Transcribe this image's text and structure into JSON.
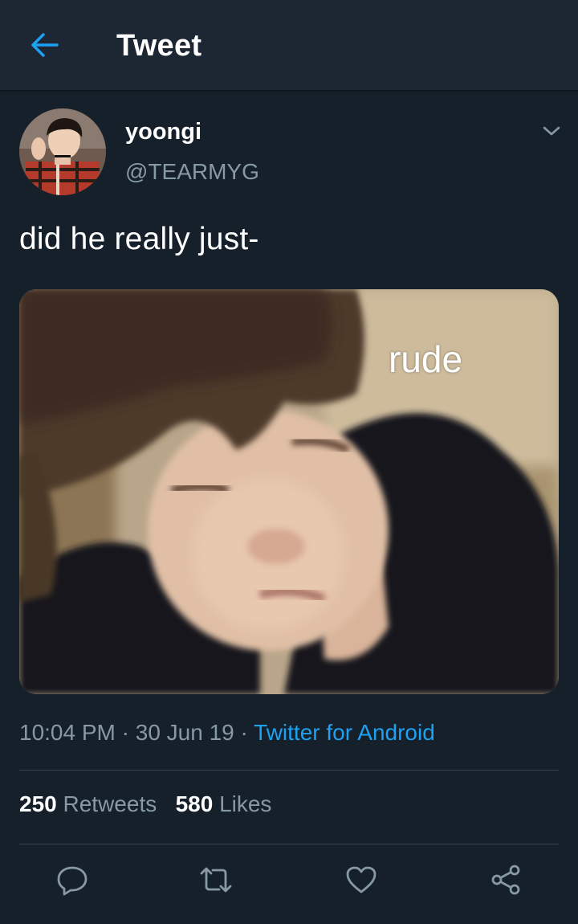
{
  "header": {
    "title": "Tweet",
    "back_icon": "arrow-left-icon"
  },
  "author": {
    "display_name": "yoongi",
    "handle": "@TEARMYG"
  },
  "tweet": {
    "text": "did he really just-",
    "media_caption": "rude"
  },
  "meta": {
    "time": "10:04 PM",
    "separator": " · ",
    "date": "30 Jun 19",
    "source": "Twitter for Android"
  },
  "stats": {
    "retweets_count": "250",
    "retweets_label": "Retweets",
    "likes_count": "580",
    "likes_label": "Likes"
  },
  "actions": [
    "reply-icon",
    "retweet-icon",
    "like-icon",
    "share-icon"
  ],
  "colors": {
    "background": "#15202b",
    "header_bg": "#1c2733",
    "accent": "#1da1f2",
    "secondary_text": "#8899a6",
    "divider": "#38444d"
  }
}
